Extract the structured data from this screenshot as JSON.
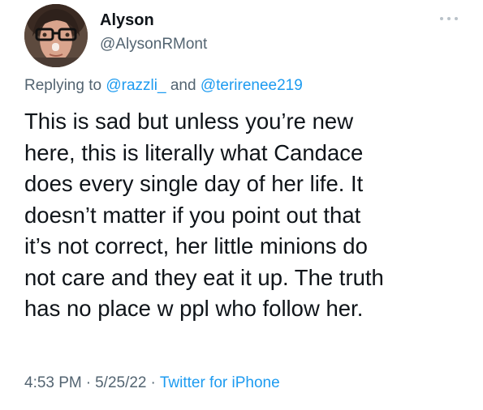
{
  "author": {
    "name": "Alyson",
    "handle": "@AlysonRMont"
  },
  "reply": {
    "prefix": "Replying to",
    "mention_1": "@razzli_",
    "joiner": "and",
    "mention_2": "@terirenee219"
  },
  "tweet": {
    "lines": [
      "This is sad but unless you’re new",
      "here, this is literally what Candace",
      "does every single day of her life. It",
      "doesn’t matter if you point out that",
      "it’s not correct, her little minions do",
      "not care and they eat it up. The truth",
      "has no place w ppl who follow her."
    ]
  },
  "meta": {
    "time": "4:53 PM",
    "separator": "·",
    "date": "5/25/22",
    "source": "Twitter for iPhone"
  },
  "icons": {
    "more": "more-horizontal-icon"
  },
  "colors": {
    "link": "#1d9bf0",
    "secondary": "#536471",
    "text": "#0f1419"
  }
}
